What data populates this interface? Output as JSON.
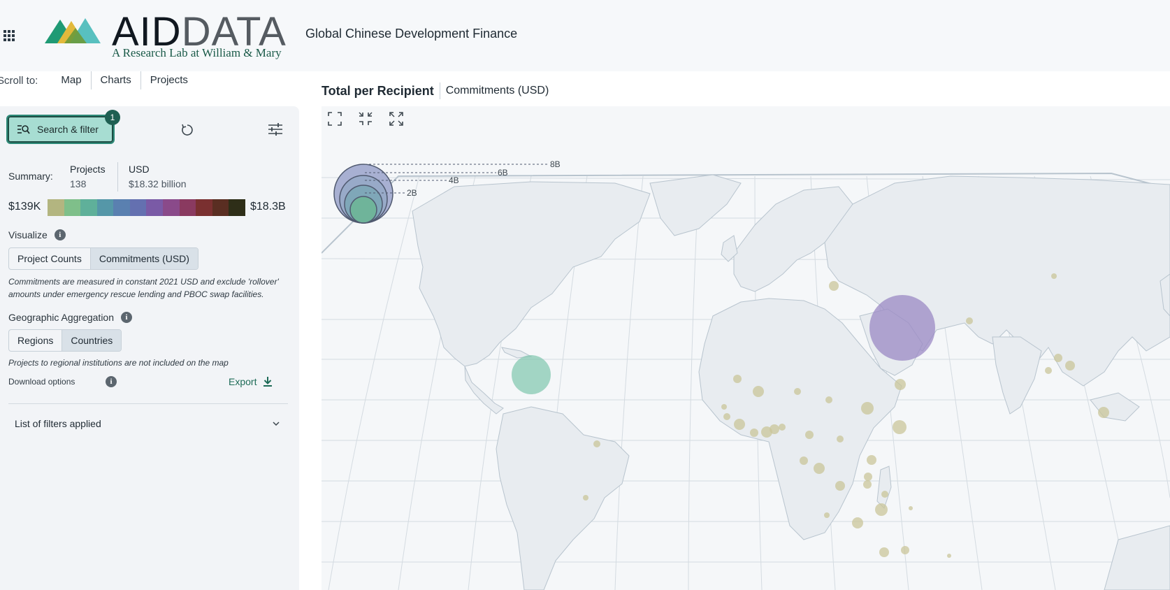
{
  "header": {
    "logo_aid": "AID",
    "logo_data": "DATA",
    "logo_tagline": "A Research Lab at William & Mary",
    "app_title": "Global Chinese Development Finance"
  },
  "scroll_nav": {
    "label": "Scroll to:",
    "links": [
      "Map",
      "Charts",
      "Projects"
    ]
  },
  "sidebar": {
    "search_filter_label": "Search & filter",
    "filter_badge": "1",
    "summary": {
      "label": "Summary:",
      "projects_header": "Projects",
      "projects_value": "138",
      "usd_header": "USD",
      "usd_value": "$18.32 billion"
    },
    "scale": {
      "min": "$139K",
      "max": "$18.3B",
      "colors": [
        "#b3b580",
        "#7fbf8a",
        "#5fb09a",
        "#5597a8",
        "#5a80b0",
        "#6470b0",
        "#7a5aa6",
        "#8a4a8a",
        "#8a3a60",
        "#7a3030",
        "#5a2e22",
        "#2e2e18"
      ]
    },
    "visualize": {
      "label": "Visualize",
      "options": [
        "Project Counts",
        "Commitments (USD)"
      ],
      "selected": "Commitments (USD)",
      "note": "Commitments are measured in constant 2021 USD and exclude 'rollover' amounts under emergency rescue lending and PBOC swap facilities."
    },
    "geo_aggregation": {
      "label": "Geographic Aggregation",
      "options": [
        "Regions",
        "Countries"
      ],
      "selected": "Countries",
      "note": "Projects to regional institutions are not included on the map"
    },
    "download": {
      "label": "Download options",
      "export_label": "Export"
    },
    "filters_list_label": "List of filters applied"
  },
  "map": {
    "title": "Total per Recipient",
    "metric": "Commitments (USD)",
    "legend_labels": [
      "8B",
      "6B",
      "4B",
      "2B"
    ],
    "colors": {
      "land": "#e8ecf0",
      "border": "#b8c4ce",
      "grid": "#d4dbe1",
      "small_bubble": "#c9c69a",
      "teal_bubble": "#7fc6ae",
      "purple_bubble": "#9b8ac4"
    }
  }
}
